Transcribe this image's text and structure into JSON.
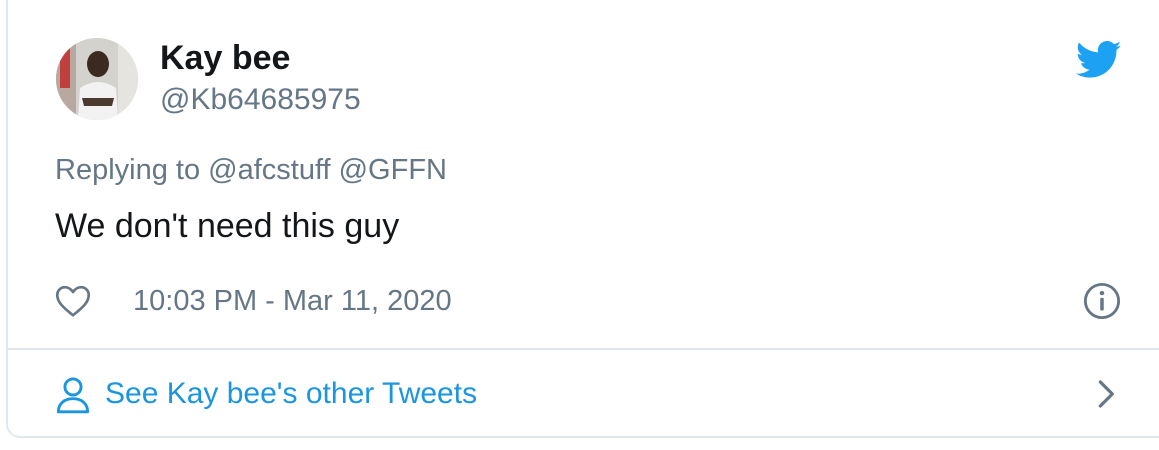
{
  "author": {
    "display_name": "Kay bee",
    "handle": "@Kb64685975"
  },
  "tweet": {
    "reply_prefix": "Replying to",
    "reply_mentions": "@afcstuff @GFFN",
    "text": "We don't need this guy",
    "timestamp": "10:03 PM - Mar 11, 2020"
  },
  "footer": {
    "link_label": "See Kay bee's other Tweets"
  },
  "icons": {
    "logo": "twitter-bird-icon",
    "like": "heart-icon",
    "info": "info-icon",
    "user": "user-icon",
    "chevron": "chevron-right-icon"
  },
  "colors": {
    "brand": "#1da1f2",
    "link": "#1b95e0",
    "text": "#14171a",
    "muted": "#657786",
    "border": "#e1e8ed"
  }
}
